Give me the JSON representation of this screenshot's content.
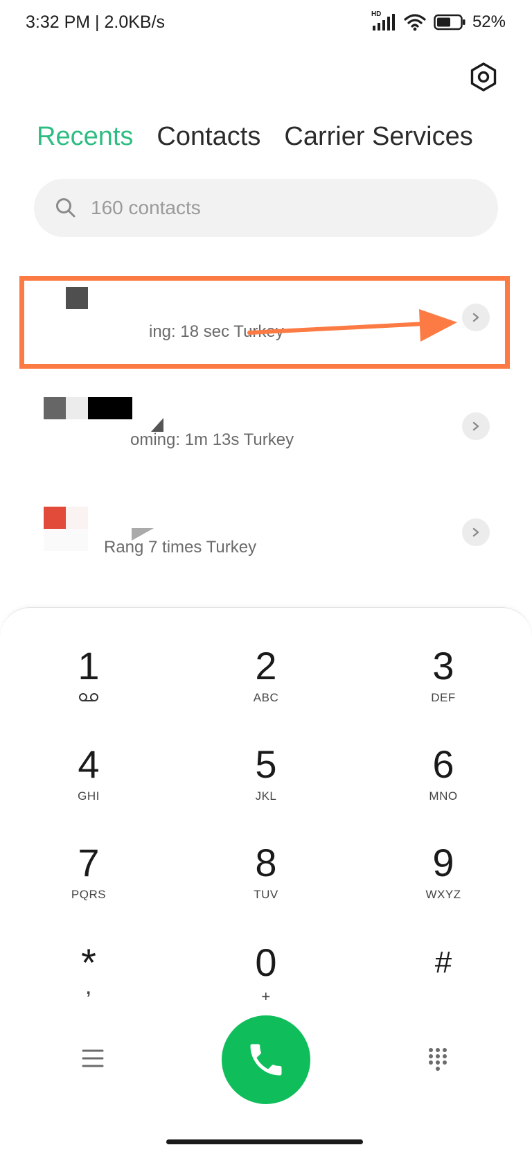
{
  "status": {
    "time": "3:32 PM | 2.0KB/s",
    "network_badge": "HD",
    "battery": "52%"
  },
  "tabs": [
    "Recents",
    "Contacts",
    "Carrier Services"
  ],
  "search": {
    "placeholder": "160 contacts"
  },
  "calls": [
    {
      "detail": "ing: 18 sec Turkey"
    },
    {
      "detail": "oming: 1m 13s Turkey"
    },
    {
      "detail": "Rang 7 times Turkey"
    }
  ],
  "dialpad": {
    "keys": [
      {
        "digit": "1",
        "letters": ""
      },
      {
        "digit": "2",
        "letters": "ABC"
      },
      {
        "digit": "3",
        "letters": "DEF"
      },
      {
        "digit": "4",
        "letters": "GHI"
      },
      {
        "digit": "5",
        "letters": "JKL"
      },
      {
        "digit": "6",
        "letters": "MNO"
      },
      {
        "digit": "7",
        "letters": "PQRS"
      },
      {
        "digit": "8",
        "letters": "TUV"
      },
      {
        "digit": "9",
        "letters": "WXYZ"
      },
      {
        "digit": "*",
        "letters": ","
      },
      {
        "digit": "0",
        "letters": "+"
      },
      {
        "digit": "#",
        "letters": ""
      }
    ]
  },
  "icons": {
    "settings": "settings-icon",
    "search": "search-icon",
    "chevron": "chevron-right-icon",
    "voicemail": "voicemail-icon",
    "menu": "menu-icon",
    "phone": "phone-icon",
    "dialpad": "dialpad-icon",
    "signal": "signal-icon",
    "wifi": "wifi-icon",
    "battery": "battery-icon"
  },
  "colors": {
    "accent": "#2dbd82",
    "call_button": "#0fbe5b",
    "annotation": "#fc7a43"
  }
}
